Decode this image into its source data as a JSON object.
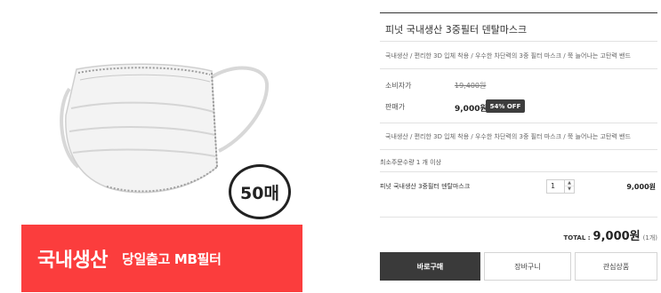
{
  "image": {
    "count_badge": "50매",
    "banner_main": "국내생산",
    "banner_sub": "당일출고 MB필터",
    "banner_color": "#fb3d3d"
  },
  "product": {
    "title": "피넛 국내생산 3중필터 덴탈마스크",
    "description_1": "국내생산 / 편리한 3D 입체 착용 / 우수한 차단력의 3중 필터 마스크 / 쭉 늘어나는 고탄력 밴드",
    "consumer_price_label": "소비자가",
    "consumer_price": "19,400원",
    "sale_price_label": "판매가",
    "sale_price": "9,000원",
    "discount_badge": "54% OFF",
    "description_2": "국내생산 / 편리한 3D 입체 착용 / 우수한 차단력의 3중 필터 마스크 / 쭉 늘어나는 고탄력 밴드",
    "min_order": "최소주문수량 1 개 이상"
  },
  "option": {
    "name": "피넛 국내생산 3중필터 덴탈마스크",
    "quantity": "1",
    "up_icon": "▲",
    "down_icon": "▼",
    "price": "9,000원"
  },
  "total": {
    "label": "TOTAL :",
    "amount": "9,000원",
    "count": "(1개)"
  },
  "buttons": {
    "buy": "바로구매",
    "cart": "장바구니",
    "wish": "관심상품"
  }
}
